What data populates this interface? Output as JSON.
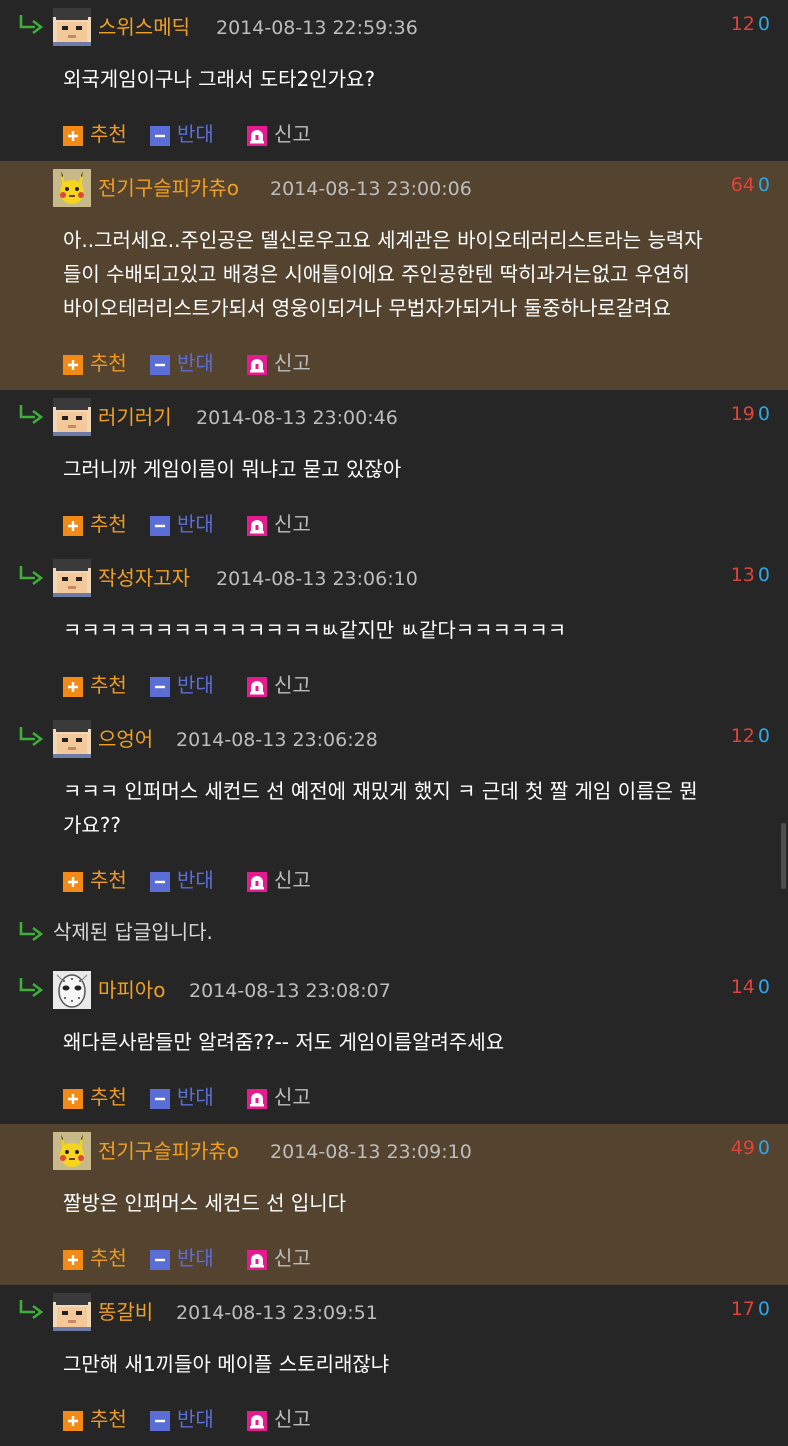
{
  "labels": {
    "recommend": "추천",
    "oppose": "반대",
    "report": "신고"
  },
  "comments": [
    {
      "type": "comment",
      "highlight": false,
      "avatar": "blocky-avatar",
      "nick": "스위스메딕",
      "date": "2014-08-13 22:59:36",
      "up": "12",
      "down": "0",
      "lines": [
        "외국게임이구나 그래서 도타2인가요?"
      ]
    },
    {
      "type": "comment",
      "highlight": true,
      "avatar": "pikachu-avatar",
      "nick": "전기구슬피카츄o",
      "date": "2014-08-13 23:00:06",
      "up": "64",
      "down": "0",
      "lines": [
        "아..그러세요..주인공은 델신로우고요 세계관은 바이오테러리스트라는 능력자",
        "들이 수배되고있고 배경은 시애틀이에요 주인공한텐 딱히과거는없고 우연히",
        "바이오테러리스트가되서 영웅이되거나 무법자가되거나 둘중하나로갈려요"
      ]
    },
    {
      "type": "comment",
      "highlight": false,
      "avatar": "blocky-avatar",
      "nick": "러기러기",
      "date": "2014-08-13 23:00:46",
      "up": "19",
      "down": "0",
      "lines": [
        "그러니까 게임이름이 뭐냐고 묻고 있잖아"
      ]
    },
    {
      "type": "comment",
      "highlight": false,
      "avatar": "blocky-avatar",
      "nick": "작성자고자",
      "date": "2014-08-13 23:06:10",
      "up": "13",
      "down": "0",
      "lines": [
        "ㅋㅋㅋㅋㅋㅋㅋㅋㅋㅋㅋㅋㅋㅋㅄ같지만 ㅄ같다ㅋㅋㅋㅋㅋㅋ"
      ]
    },
    {
      "type": "comment",
      "highlight": false,
      "avatar": "blocky-avatar",
      "nick": "으엉어",
      "date": "2014-08-13 23:06:28",
      "up": "12",
      "down": "0",
      "lines": [
        "ㅋㅋㅋ 인퍼머스 세컨드 선 예전에 재밌게 했지 ㅋ 근데 첫 짤 게임 이름은 뭔",
        "가요??"
      ]
    },
    {
      "type": "deleted",
      "text": "삭제된 답글입니다."
    },
    {
      "type": "comment",
      "highlight": false,
      "avatar": "mask-avatar",
      "nick": "마피아o",
      "date": "2014-08-13 23:08:07",
      "up": "14",
      "down": "0",
      "lines": [
        "왜다른사람들만 알려줌??-- 저도 게임이름알려주세요"
      ]
    },
    {
      "type": "comment",
      "highlight": true,
      "avatar": "pikachu-avatar",
      "nick": "전기구슬피카츄o",
      "date": "2014-08-13 23:09:10",
      "up": "49",
      "down": "0",
      "lines": [
        "짤방은 인퍼머스 세컨드 선 입니다"
      ]
    },
    {
      "type": "comment",
      "highlight": false,
      "avatar": "blocky-avatar",
      "nick": "똥갈비",
      "date": "2014-08-13 23:09:51",
      "up": "17",
      "down": "0",
      "lines": [
        "그만해 새1끼들아 메이플 스토리래잖냐"
      ]
    }
  ],
  "colors": {
    "background": "#262626",
    "highlight": "#54432f",
    "nickname": "#f0a022",
    "upvote": "#e0433b",
    "downvote": "#2fa6e6",
    "reply_arrow": "#3fae3a"
  }
}
